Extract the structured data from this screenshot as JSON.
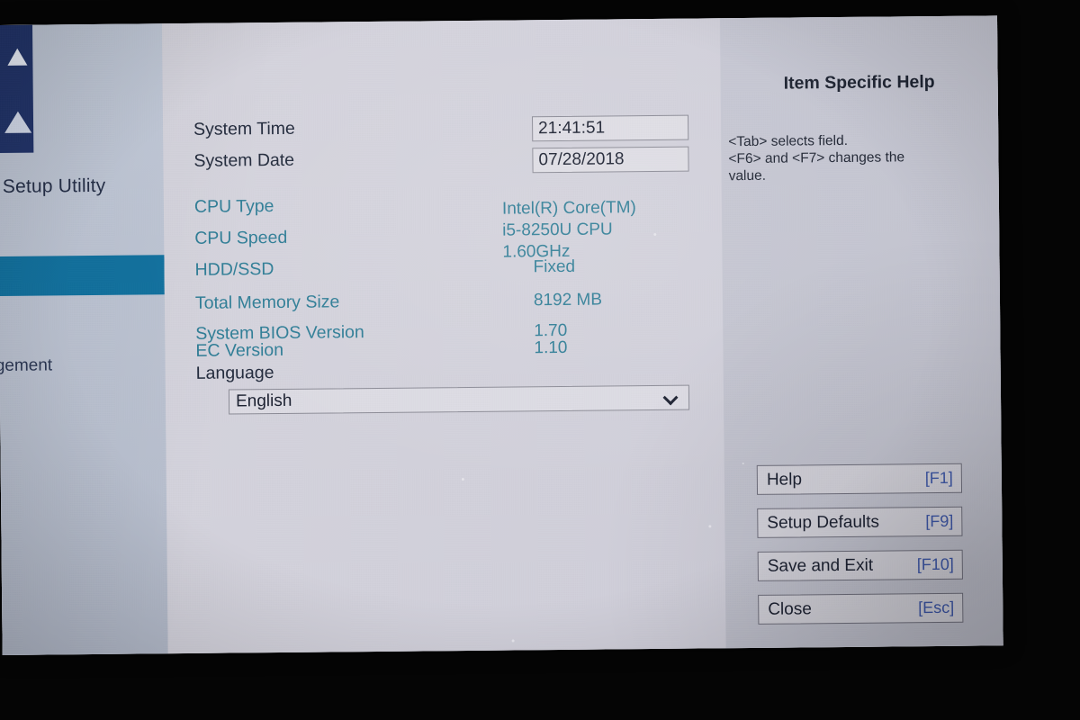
{
  "sidebar": {
    "brand_logo_icon": "manufacturer-logo-icon",
    "setup_title": "A Setup Utility",
    "items": [
      {
        "label": "",
        "selected": true
      },
      {
        "label": "nagement",
        "selected": false
      },
      {
        "label": "ı",
        "selected": false
      }
    ]
  },
  "main": {
    "rows": [
      {
        "label": "System Time",
        "label_style": "dark",
        "value": "21:41:51",
        "control": "textbox"
      },
      {
        "label": "System Date",
        "label_style": "dark",
        "value": "07/28/2018",
        "control": "textbox"
      },
      {
        "label": "CPU Type",
        "label_style": "teal",
        "value": "",
        "control": "text"
      },
      {
        "label": "CPU Speed",
        "label_style": "teal",
        "value": "",
        "control": "text"
      },
      {
        "label": "HDD/SSD",
        "label_style": "teal",
        "value": "Fixed",
        "control": "text"
      },
      {
        "label": "Total Memory Size",
        "label_style": "teal",
        "value": "8192 MB",
        "control": "text"
      },
      {
        "label": "System BIOS Version",
        "label_style": "teal",
        "value": "1.70",
        "control": "text"
      },
      {
        "label": "EC Version",
        "label_style": "teal",
        "value": "1.10",
        "control": "text"
      }
    ],
    "cpu_value_lines": [
      "Intel(R) Core(TM)",
      "i5-8250U CPU",
      "1.60GHz"
    ],
    "language": {
      "label": "Language",
      "selected_option": "English",
      "dropdown_icon": "chevron-down-icon"
    }
  },
  "help": {
    "title": "Item Specific Help",
    "lines": [
      "<Tab> selects field.",
      "<F6> and <F7> changes the",
      "value."
    ]
  },
  "actions": [
    {
      "label": "Help",
      "key": "[F1]"
    },
    {
      "label": "Setup Defaults",
      "key": "[F9]"
    },
    {
      "label": "Save and Exit",
      "key": "[F10]"
    },
    {
      "label": "Close",
      "key": "[Esc]"
    }
  ],
  "colors": {
    "accent_selected": "#1272a0",
    "info_teal": "#2e7d96",
    "label_dark": "#222a3c",
    "key_blue": "#3d57a8",
    "logo_navy": "#22346b"
  }
}
